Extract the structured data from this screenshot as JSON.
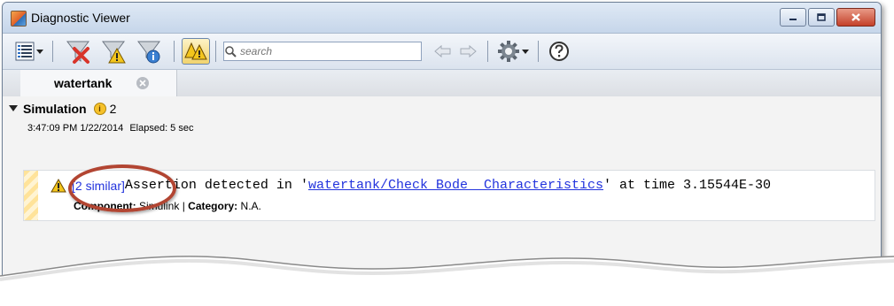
{
  "window": {
    "title": "Diagnostic Viewer"
  },
  "toolbar": {
    "search_placeholder": "search",
    "icons": [
      "view-mode-icon",
      "clear-icon",
      "filter-warning-icon",
      "filter-info-icon",
      "group-warnings-icon",
      "back-arrow-icon",
      "forward-arrow-icon",
      "settings-gear-icon",
      "help-icon"
    ]
  },
  "tabs": [
    {
      "label": "watertank"
    }
  ],
  "simulation": {
    "title": "Simulation",
    "count": "2",
    "timestamp": "3:47:09 PM 1/22/2014",
    "elapsed": "Elapsed: 5 sec"
  },
  "diagnostic": {
    "similar": "[2 similar]",
    "message_prefix": "Assertion detected in '",
    "block_link": "watertank/Check Bode  Characteristics",
    "message_suffix": "' at time 3.15544E-30",
    "component_label": "Component:",
    "component_value": "Simulink",
    "separator": "|",
    "category_label": "Category:",
    "category_value": "N.A."
  },
  "colors": {
    "link": "#2233dd",
    "highlight": "#b24532",
    "warning": "#f3c51c"
  }
}
